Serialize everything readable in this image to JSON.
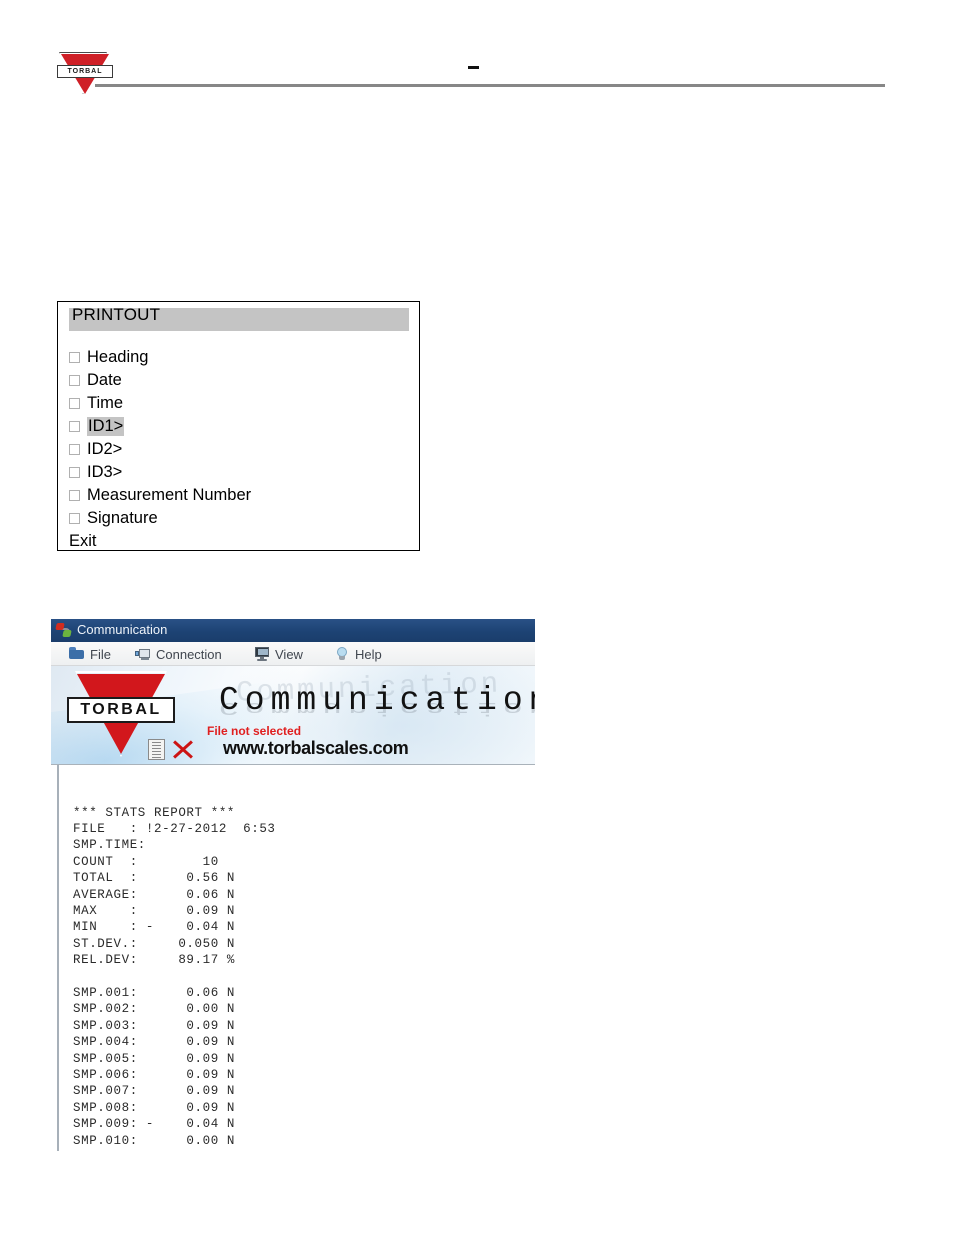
{
  "page_header": {
    "logo_text": "TORBAL",
    "dash_mark": "–"
  },
  "printout_panel": {
    "title": "PRINTOUT",
    "items": [
      {
        "label": "Heading",
        "checkbox": true,
        "checked": false,
        "selected": false
      },
      {
        "label": "Date",
        "checkbox": true,
        "checked": false,
        "selected": false
      },
      {
        "label": "Time",
        "checkbox": true,
        "checked": false,
        "selected": false
      },
      {
        "label": "ID1>",
        "checkbox": true,
        "checked": false,
        "selected": true
      },
      {
        "label": "ID2>",
        "checkbox": true,
        "checked": false,
        "selected": false
      },
      {
        "label": "ID3>",
        "checkbox": true,
        "checked": false,
        "selected": false
      },
      {
        "label": "Measurement Number",
        "checkbox": true,
        "checked": false,
        "selected": false
      },
      {
        "label": "Signature",
        "checkbox": true,
        "checked": false,
        "selected": false
      },
      {
        "label": "Exit",
        "checkbox": false,
        "checked": false,
        "selected": false
      }
    ]
  },
  "comm_window": {
    "title": "Communication",
    "app_icon": "connection-icon",
    "menu": [
      {
        "label": "File",
        "icon": "folder-icon"
      },
      {
        "label": "Connection",
        "icon": "network-computer-icon"
      },
      {
        "label": "View",
        "icon": "monitor-icon"
      },
      {
        "label": "Help",
        "icon": "lightbulb-icon"
      }
    ],
    "banner": {
      "logo_text": "TORBAL",
      "title": "Communication",
      "status": "File not selected",
      "status_color": "#e02020",
      "url": "www.torbalscales.com",
      "doc_icon": "document-icon",
      "x_icon": "red-x-icon",
      "ghost_text": "Communication"
    },
    "report": {
      "header": "*** STATS REPORT ***",
      "lines": [
        "*** STATS REPORT ***",
        "FILE   : !2-27-2012  6:53",
        "SMP.TIME:",
        "COUNT  :        10",
        "TOTAL  :      0.56 N",
        "AVERAGE:      0.06 N",
        "MAX    :      0.09 N",
        "MIN    : -    0.04 N",
        "ST.DEV.:     0.050 N",
        "REL.DEV:     89.17 %",
        "",
        "SMP.001:      0.06 N",
        "SMP.002:      0.00 N",
        "SMP.003:      0.09 N",
        "SMP.004:      0.09 N",
        "SMP.005:      0.09 N",
        "SMP.006:      0.09 N",
        "SMP.007:      0.09 N",
        "SMP.008:      0.09 N",
        "SMP.009: -    0.04 N",
        "SMP.010:      0.00 N"
      ],
      "text": "*** STATS REPORT ***\nFILE   : !2-27-2012  6:53\nSMP.TIME:\nCOUNT  :        10\nTOTAL  :      0.56 N\nAVERAGE:      0.06 N\nMAX    :      0.09 N\nMIN    : -    0.04 N\nST.DEV.:     0.050 N\nREL.DEV:     89.17 %\n\nSMP.001:      0.06 N\nSMP.002:      0.00 N\nSMP.003:      0.09 N\nSMP.004:      0.09 N\nSMP.005:      0.09 N\nSMP.006:      0.09 N\nSMP.007:      0.09 N\nSMP.008:      0.09 N\nSMP.009: -    0.04 N\nSMP.010:      0.00 N",
      "stats": {
        "file": "!2-27-2012  6:53",
        "smp_time": "",
        "count": "10",
        "total": "0.56 N",
        "average": "0.06 N",
        "max": "0.09 N",
        "min": "- 0.04 N",
        "st_dev": "0.050 N",
        "rel_dev": "89.17 %"
      },
      "samples": [
        {
          "id": "SMP.001",
          "value": "0.06 N"
        },
        {
          "id": "SMP.002",
          "value": "0.00 N"
        },
        {
          "id": "SMP.003",
          "value": "0.09 N"
        },
        {
          "id": "SMP.004",
          "value": "0.09 N"
        },
        {
          "id": "SMP.005",
          "value": "0.09 N"
        },
        {
          "id": "SMP.006",
          "value": "0.09 N"
        },
        {
          "id": "SMP.007",
          "value": "0.09 N"
        },
        {
          "id": "SMP.008",
          "value": "0.09 N"
        },
        {
          "id": "SMP.009",
          "value": "- 0.04 N"
        },
        {
          "id": "SMP.010",
          "value": "0.00 N"
        }
      ]
    }
  }
}
